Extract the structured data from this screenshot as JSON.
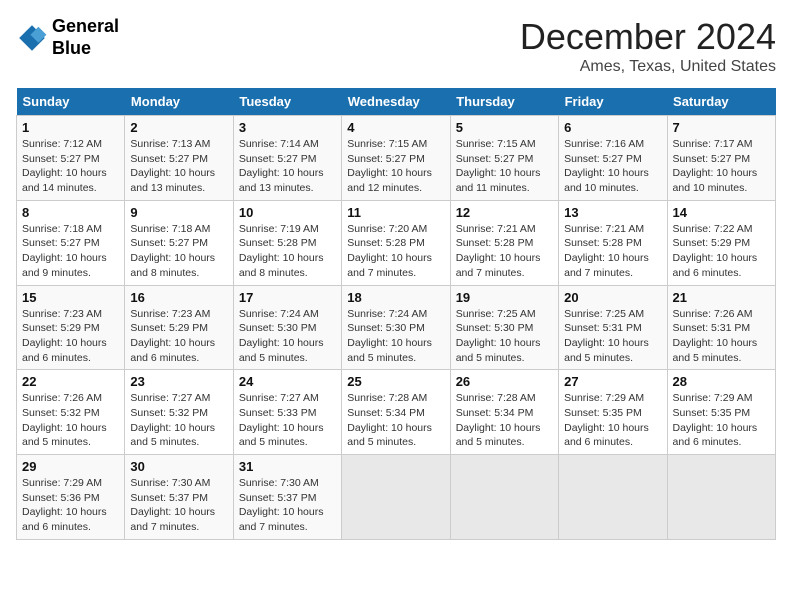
{
  "logo": {
    "line1": "General",
    "line2": "Blue"
  },
  "title": "December 2024",
  "location": "Ames, Texas, United States",
  "weekdays": [
    "Sunday",
    "Monday",
    "Tuesday",
    "Wednesday",
    "Thursday",
    "Friday",
    "Saturday"
  ],
  "weeks": [
    [
      {
        "day": "1",
        "info": "Sunrise: 7:12 AM\nSunset: 5:27 PM\nDaylight: 10 hours\nand 14 minutes."
      },
      {
        "day": "2",
        "info": "Sunrise: 7:13 AM\nSunset: 5:27 PM\nDaylight: 10 hours\nand 13 minutes."
      },
      {
        "day": "3",
        "info": "Sunrise: 7:14 AM\nSunset: 5:27 PM\nDaylight: 10 hours\nand 13 minutes."
      },
      {
        "day": "4",
        "info": "Sunrise: 7:15 AM\nSunset: 5:27 PM\nDaylight: 10 hours\nand 12 minutes."
      },
      {
        "day": "5",
        "info": "Sunrise: 7:15 AM\nSunset: 5:27 PM\nDaylight: 10 hours\nand 11 minutes."
      },
      {
        "day": "6",
        "info": "Sunrise: 7:16 AM\nSunset: 5:27 PM\nDaylight: 10 hours\nand 10 minutes."
      },
      {
        "day": "7",
        "info": "Sunrise: 7:17 AM\nSunset: 5:27 PM\nDaylight: 10 hours\nand 10 minutes."
      }
    ],
    [
      {
        "day": "8",
        "info": "Sunrise: 7:18 AM\nSunset: 5:27 PM\nDaylight: 10 hours\nand 9 minutes."
      },
      {
        "day": "9",
        "info": "Sunrise: 7:18 AM\nSunset: 5:27 PM\nDaylight: 10 hours\nand 8 minutes."
      },
      {
        "day": "10",
        "info": "Sunrise: 7:19 AM\nSunset: 5:28 PM\nDaylight: 10 hours\nand 8 minutes."
      },
      {
        "day": "11",
        "info": "Sunrise: 7:20 AM\nSunset: 5:28 PM\nDaylight: 10 hours\nand 7 minutes."
      },
      {
        "day": "12",
        "info": "Sunrise: 7:21 AM\nSunset: 5:28 PM\nDaylight: 10 hours\nand 7 minutes."
      },
      {
        "day": "13",
        "info": "Sunrise: 7:21 AM\nSunset: 5:28 PM\nDaylight: 10 hours\nand 7 minutes."
      },
      {
        "day": "14",
        "info": "Sunrise: 7:22 AM\nSunset: 5:29 PM\nDaylight: 10 hours\nand 6 minutes."
      }
    ],
    [
      {
        "day": "15",
        "info": "Sunrise: 7:23 AM\nSunset: 5:29 PM\nDaylight: 10 hours\nand 6 minutes."
      },
      {
        "day": "16",
        "info": "Sunrise: 7:23 AM\nSunset: 5:29 PM\nDaylight: 10 hours\nand 6 minutes."
      },
      {
        "day": "17",
        "info": "Sunrise: 7:24 AM\nSunset: 5:30 PM\nDaylight: 10 hours\nand 5 minutes."
      },
      {
        "day": "18",
        "info": "Sunrise: 7:24 AM\nSunset: 5:30 PM\nDaylight: 10 hours\nand 5 minutes."
      },
      {
        "day": "19",
        "info": "Sunrise: 7:25 AM\nSunset: 5:30 PM\nDaylight: 10 hours\nand 5 minutes."
      },
      {
        "day": "20",
        "info": "Sunrise: 7:25 AM\nSunset: 5:31 PM\nDaylight: 10 hours\nand 5 minutes."
      },
      {
        "day": "21",
        "info": "Sunrise: 7:26 AM\nSunset: 5:31 PM\nDaylight: 10 hours\nand 5 minutes."
      }
    ],
    [
      {
        "day": "22",
        "info": "Sunrise: 7:26 AM\nSunset: 5:32 PM\nDaylight: 10 hours\nand 5 minutes."
      },
      {
        "day": "23",
        "info": "Sunrise: 7:27 AM\nSunset: 5:32 PM\nDaylight: 10 hours\nand 5 minutes."
      },
      {
        "day": "24",
        "info": "Sunrise: 7:27 AM\nSunset: 5:33 PM\nDaylight: 10 hours\nand 5 minutes."
      },
      {
        "day": "25",
        "info": "Sunrise: 7:28 AM\nSunset: 5:34 PM\nDaylight: 10 hours\nand 5 minutes."
      },
      {
        "day": "26",
        "info": "Sunrise: 7:28 AM\nSunset: 5:34 PM\nDaylight: 10 hours\nand 5 minutes."
      },
      {
        "day": "27",
        "info": "Sunrise: 7:29 AM\nSunset: 5:35 PM\nDaylight: 10 hours\nand 6 minutes."
      },
      {
        "day": "28",
        "info": "Sunrise: 7:29 AM\nSunset: 5:35 PM\nDaylight: 10 hours\nand 6 minutes."
      }
    ],
    [
      {
        "day": "29",
        "info": "Sunrise: 7:29 AM\nSunset: 5:36 PM\nDaylight: 10 hours\nand 6 minutes."
      },
      {
        "day": "30",
        "info": "Sunrise: 7:30 AM\nSunset: 5:37 PM\nDaylight: 10 hours\nand 7 minutes."
      },
      {
        "day": "31",
        "info": "Sunrise: 7:30 AM\nSunset: 5:37 PM\nDaylight: 10 hours\nand 7 minutes."
      },
      null,
      null,
      null,
      null
    ]
  ]
}
